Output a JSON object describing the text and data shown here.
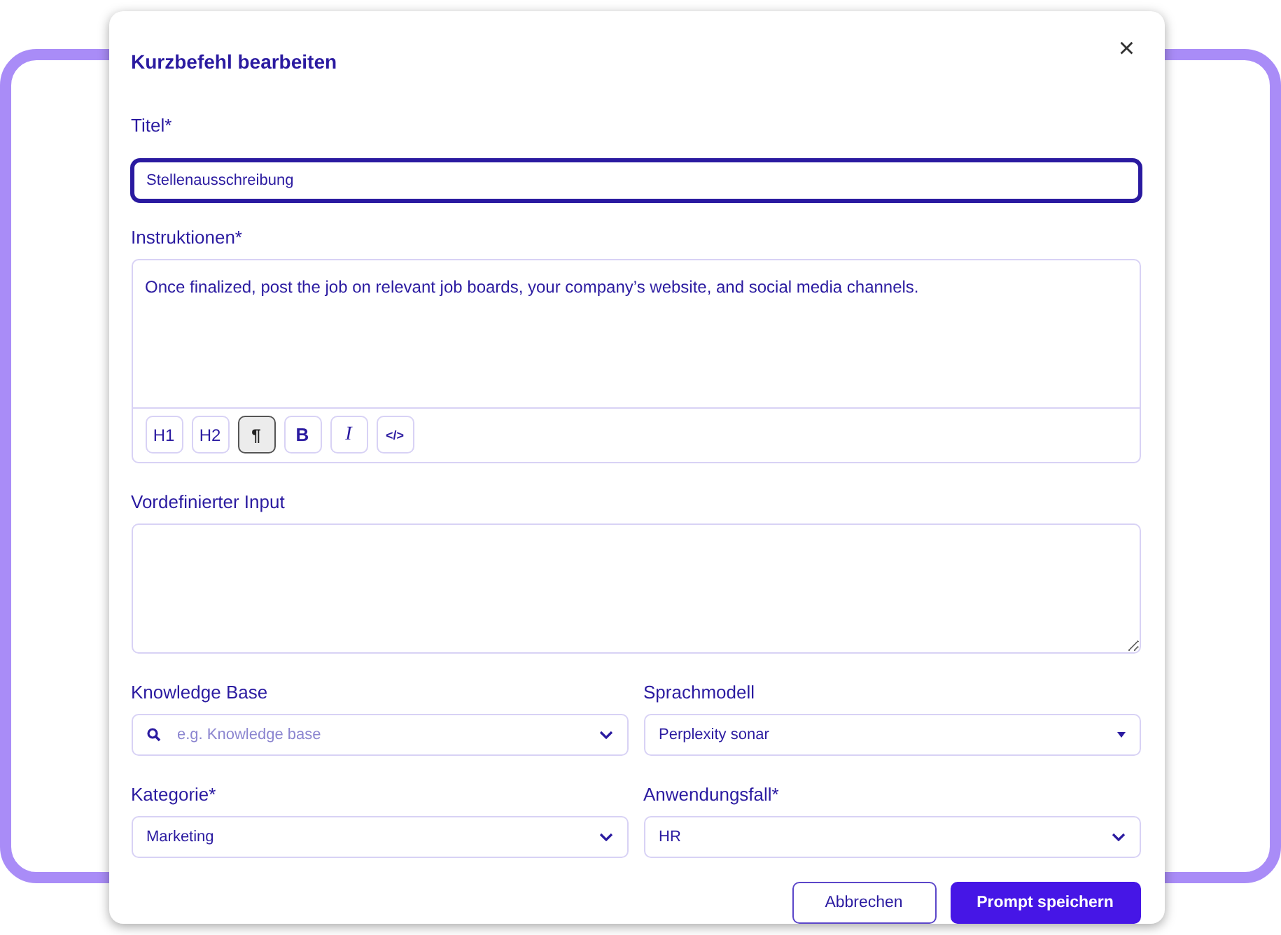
{
  "dialog": {
    "title": "Kurzbefehl bearbeiten",
    "close": "×"
  },
  "title_field": {
    "label": "Titel*",
    "value": "Stellenausschreibung",
    "focused": true
  },
  "instructions": {
    "label": "Instruktionen*",
    "value": "Once finalized, post the job on relevant job boards, your company’s website, and social media channels.",
    "toolbar": [
      {
        "label": "H1",
        "kind": "heading",
        "selected": false
      },
      {
        "label": "H2",
        "kind": "heading",
        "selected": false
      },
      {
        "label": "¶",
        "kind": "paragraph",
        "selected": true
      },
      {
        "label": "B",
        "kind": "bold",
        "selected": false
      },
      {
        "label": "I",
        "kind": "italic",
        "selected": false
      },
      {
        "label": "</>",
        "kind": "code",
        "selected": false
      }
    ]
  },
  "predefined_input": {
    "label": "Vordefinierter Input"
  },
  "selects": [
    {
      "label": "Knowledge Base",
      "kind": "search",
      "placeholder": "e.g. Knowledge base"
    },
    {
      "label": "Sprachmodell",
      "kind": "native",
      "value": "Perplexity sonar"
    },
    {
      "label": "Kategorie*",
      "kind": "chevron",
      "value": "Marketing"
    },
    {
      "label": "Anwendungsfall*",
      "kind": "chevron",
      "value": "HR"
    }
  ],
  "buttons": [
    {
      "label": "Abbrechen",
      "kind": "secondary"
    },
    {
      "label": "Prompt speichern",
      "kind": "primary"
    }
  ]
}
